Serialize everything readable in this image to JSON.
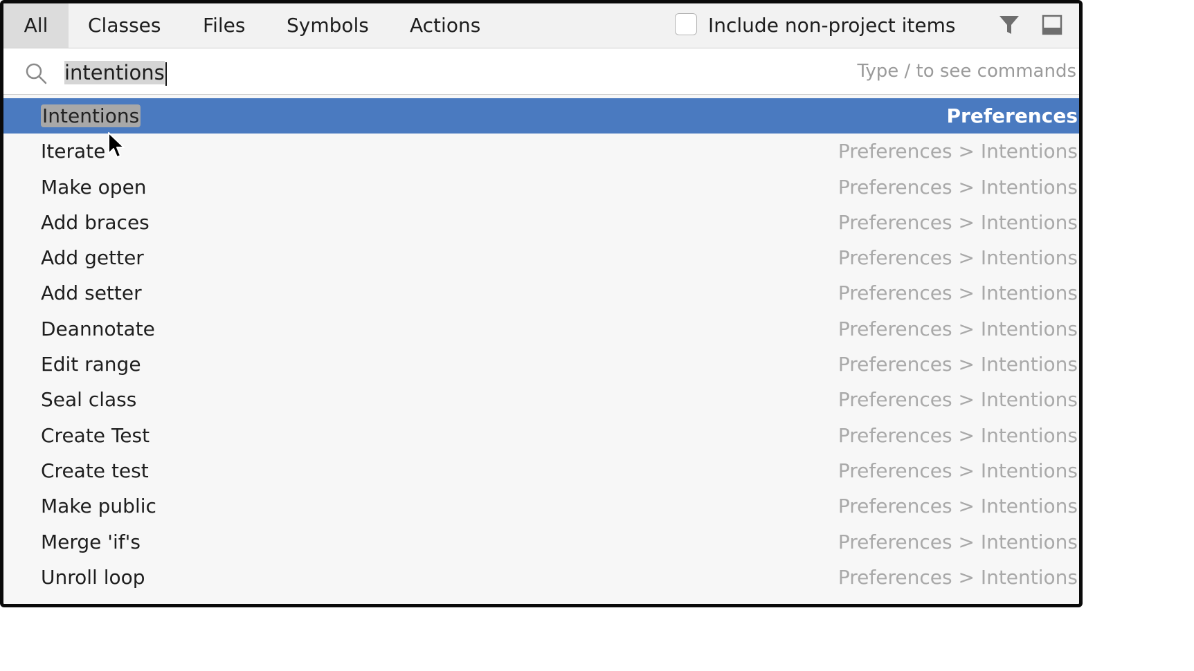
{
  "tabs": [
    {
      "label": "All",
      "active": true
    },
    {
      "label": "Classes",
      "active": false
    },
    {
      "label": "Files",
      "active": false
    },
    {
      "label": "Symbols",
      "active": false
    },
    {
      "label": "Actions",
      "active": false
    }
  ],
  "include_non_project": {
    "label": "Include non-project items",
    "checked": false
  },
  "toolbar": {
    "filter_icon": "filter-icon",
    "preview_icon": "preview-panel-icon"
  },
  "search": {
    "icon": "search-icon",
    "value": "intentions",
    "hint": "Type / to see commands"
  },
  "results": [
    {
      "name": "Intentions",
      "path": "Preferences",
      "selected": true
    },
    {
      "name": "Iterate",
      "path": "Preferences > Intentions"
    },
    {
      "name": "Make open",
      "path": "Preferences > Intentions"
    },
    {
      "name": "Add braces",
      "path": "Preferences > Intentions"
    },
    {
      "name": "Add getter",
      "path": "Preferences > Intentions"
    },
    {
      "name": "Add setter",
      "path": "Preferences > Intentions"
    },
    {
      "name": "Deannotate",
      "path": "Preferences > Intentions"
    },
    {
      "name": "Edit range",
      "path": "Preferences > Intentions"
    },
    {
      "name": "Seal class",
      "path": "Preferences > Intentions"
    },
    {
      "name": "Create Test",
      "path": "Preferences > Intentions"
    },
    {
      "name": "Create test",
      "path": "Preferences > Intentions"
    },
    {
      "name": "Make public",
      "path": "Preferences > Intentions"
    },
    {
      "name": "Merge 'if's",
      "path": "Preferences > Intentions"
    },
    {
      "name": "Unroll loop",
      "path": "Preferences > Intentions"
    }
  ],
  "colors": {
    "selection": "#4a7ac0",
    "match_highlight": "#a8a8a8"
  }
}
